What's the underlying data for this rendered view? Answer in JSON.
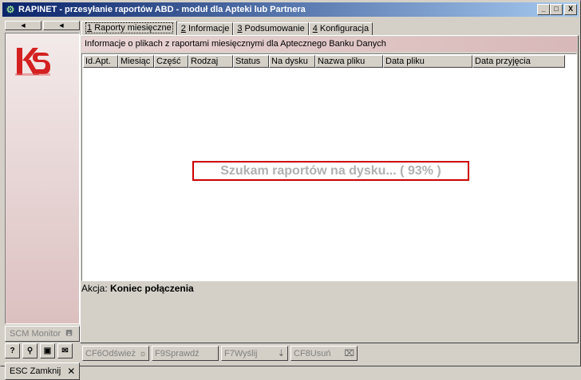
{
  "window": {
    "title": "RAPINET - przesyłanie raportów ABD - moduł dla Apteki lub Partnera",
    "controls": [
      "_",
      "□",
      "X"
    ]
  },
  "left": {
    "scm_label": "SCM Monitor",
    "esc_label": "ESC Zamknij",
    "small_buttons": [
      "?",
      "search",
      "image",
      "mail"
    ]
  },
  "tabs": [
    {
      "num": "1",
      "label": "Raporty miesięczne",
      "active": true
    },
    {
      "num": "2",
      "label": "Informacje"
    },
    {
      "num": "3",
      "label": "Podsumowanie"
    },
    {
      "num": "4",
      "label": "Konfiguracja"
    }
  ],
  "main": {
    "info": "Informacje o plikach z raportami miesięcznymi dla Aptecznego Banku Danych",
    "columns": [
      "Id.Apt.",
      "Miesiąc",
      "Część",
      "Rodzaj",
      "Status",
      "Na dysku",
      "Nazwa pliku",
      "Data pliku",
      "Data przyjęcia"
    ],
    "searching": "Szukam raportów na dysku... ( 93% )",
    "action_label": "Akcja:",
    "action_value": "Koniec połączenia"
  },
  "footer": {
    "buttons": [
      {
        "key": "CF6",
        "label": "Odśwież",
        "icon": "sun-icon"
      },
      {
        "key": "F9",
        "label": "Sprawdź"
      },
      {
        "key": "F7",
        "label": "Wyślij",
        "icon": "send-icon"
      },
      {
        "key": "CF8",
        "label": "Usuń",
        "icon": "delete-icon"
      }
    ]
  }
}
